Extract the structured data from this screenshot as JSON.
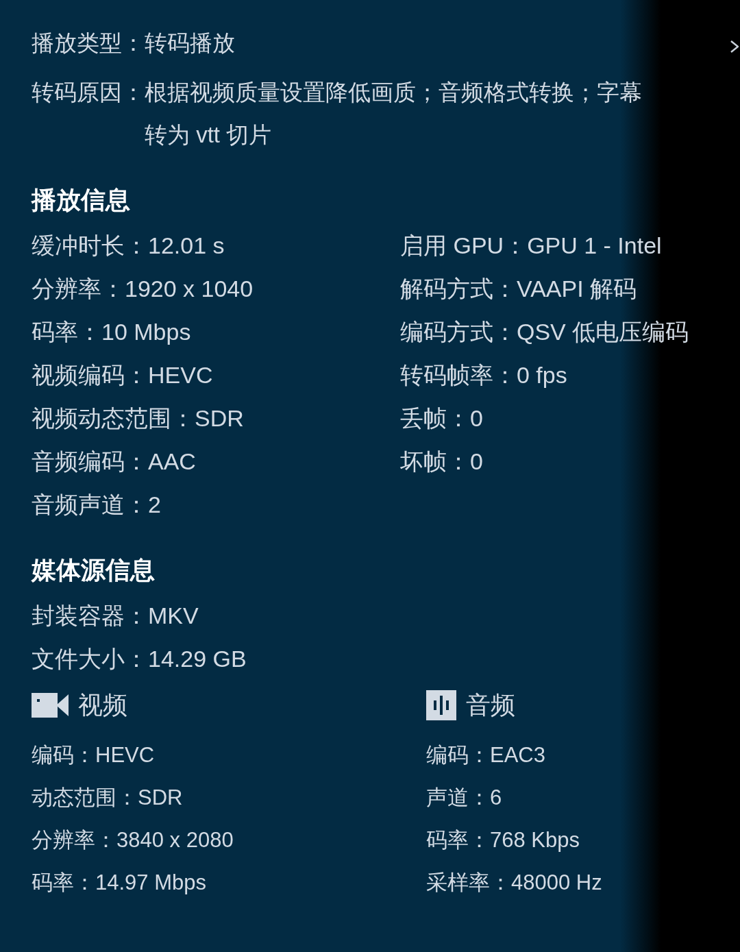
{
  "summary": [
    {
      "label": "播放类型：",
      "value": "转码播放"
    },
    {
      "label": "转码原因：",
      "value": "根据视频质量设置降低画质；音频格式转换；字幕转为 vtt 切片"
    }
  ],
  "playback": {
    "title": "播放信息",
    "left": [
      {
        "label": "缓冲时长：",
        "value": "12.01 s"
      },
      {
        "label": "分辨率：",
        "value": "1920 x 1040"
      },
      {
        "label": "码率：",
        "value": "10 Mbps"
      },
      {
        "label": "视频编码：",
        "value": "HEVC"
      },
      {
        "label": "视频动态范围：",
        "value": "SDR"
      },
      {
        "label": "音频编码：",
        "value": "AAC"
      },
      {
        "label": "音频声道：",
        "value": "2"
      }
    ],
    "right": [
      {
        "label": "启用 GPU：",
        "value": "GPU 1 - Intel"
      },
      {
        "label": "解码方式：",
        "value": "VAAPI 解码"
      },
      {
        "label": "编码方式：",
        "value": "QSV 低电压编码"
      },
      {
        "label": "转码帧率：",
        "value": "0 fps"
      },
      {
        "label": "丢帧：",
        "value": "0"
      },
      {
        "label": "坏帧：",
        "value": "0"
      }
    ]
  },
  "media_source": {
    "title": "媒体源信息",
    "rows": [
      {
        "label": "封装容器：",
        "value": "MKV"
      },
      {
        "label": "文件大小：",
        "value": "14.29 GB"
      }
    ],
    "streams": [
      {
        "kind": "video",
        "title": "视频",
        "rows": [
          {
            "label": "编码：",
            "value": "HEVC"
          },
          {
            "label": "动态范围：",
            "value": "SDR"
          },
          {
            "label": "分辨率：",
            "value": "3840 x 2080"
          },
          {
            "label": "码率：",
            "value": "14.97 Mbps"
          }
        ]
      },
      {
        "kind": "audio",
        "title": "音频",
        "rows": [
          {
            "label": "编码：",
            "value": "EAC3"
          },
          {
            "label": "声道：",
            "value": "6"
          },
          {
            "label": "码率：",
            "value": "768 Kbps"
          },
          {
            "label": "采样率：",
            "value": "48000 Hz"
          }
        ]
      }
    ]
  }
}
